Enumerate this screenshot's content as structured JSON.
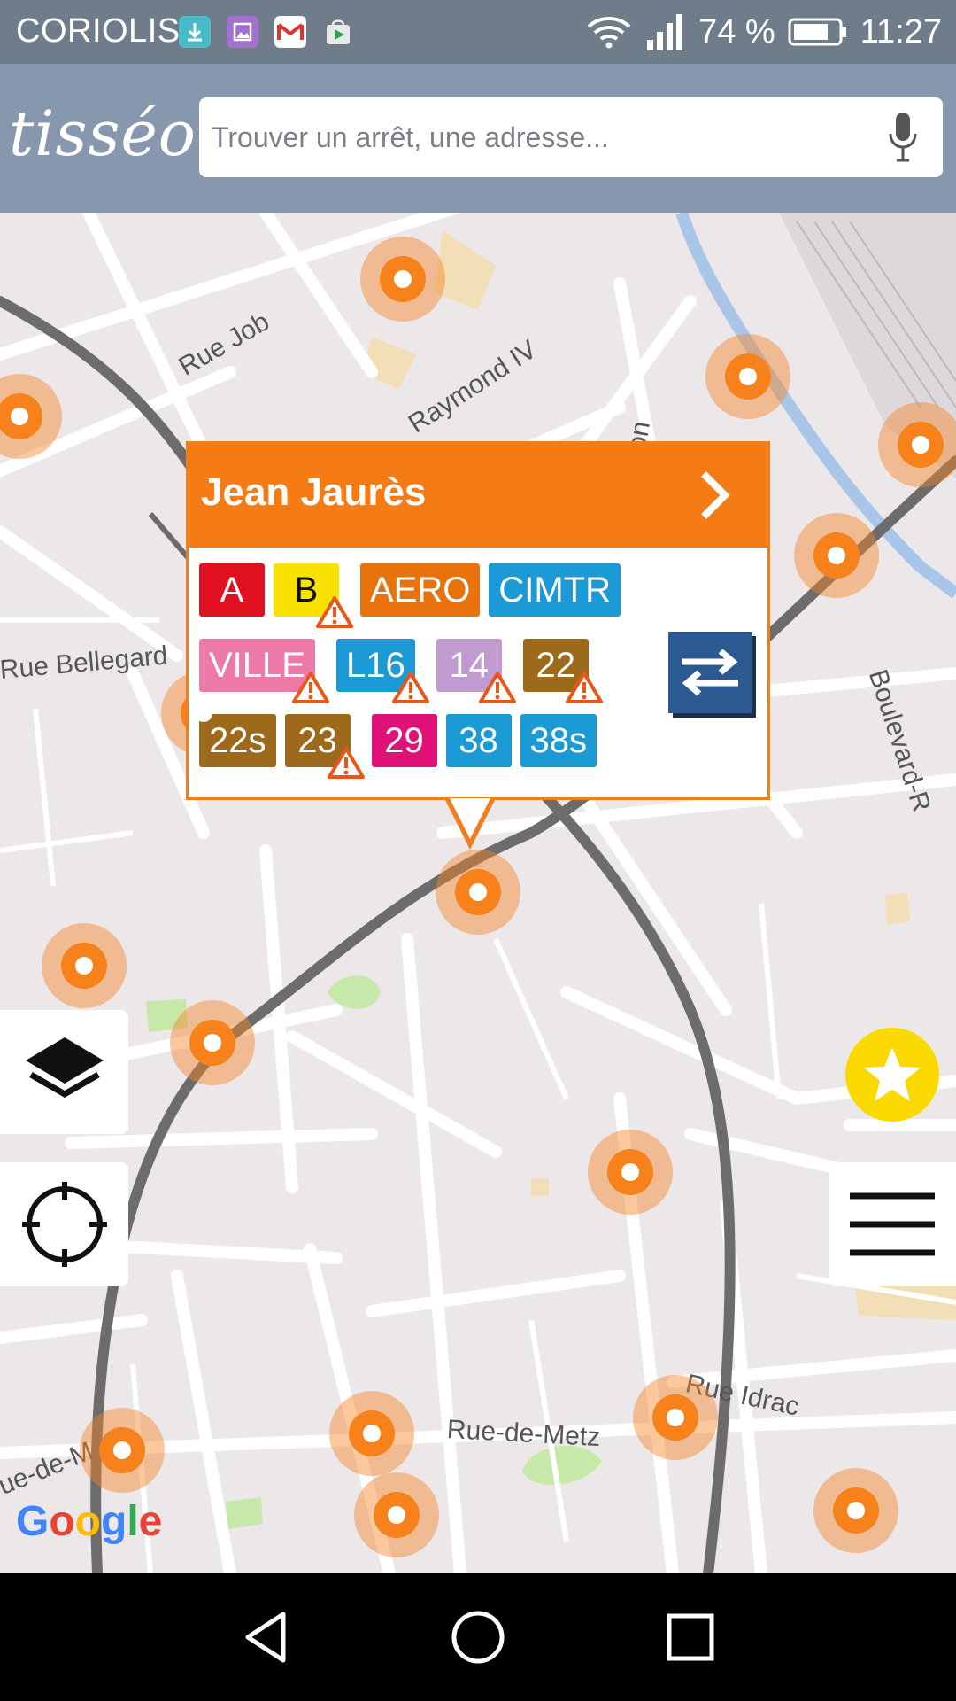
{
  "status_bar": {
    "carrier": "CORIOLIS",
    "battery": "74 %",
    "time": "11:27",
    "icons": [
      "download-icon",
      "gallery-icon",
      "gmail-icon",
      "play-store-icon",
      "wifi-icon",
      "signal-icon",
      "battery-icon"
    ]
  },
  "header": {
    "logo": "tisséo",
    "search_placeholder": "Trouver un arrêt, une adresse...",
    "mic_icon": "microphone-icon"
  },
  "map": {
    "street_labels": [
      "Rue Job",
      "Raymond IV",
      "Rue Bellegard",
      "Boulevard-R",
      "Rue Idrac",
      "Rue-de-Metz",
      "ue-de-M",
      "fon"
    ],
    "attribution": "Google"
  },
  "popup": {
    "stop_name": "Jean Jaurès",
    "lines": [
      [
        {
          "label": "A",
          "bg": "#df1020",
          "fg": "#ffffff",
          "alert": false
        },
        {
          "label": "B",
          "bg": "#f9e200",
          "fg": "#111111",
          "alert": true
        },
        {
          "label": "AERO",
          "bg": "#e8730c",
          "fg": "#ffffff",
          "alert": false
        },
        {
          "label": "CIMTR",
          "bg": "#1c9ad6",
          "fg": "#ffffff",
          "alert": false
        }
      ],
      [
        {
          "label": "VILLE",
          "bg": "#ec79a8",
          "fg": "#ffffff",
          "alert": true
        },
        {
          "label": "L16",
          "bg": "#1c9ad6",
          "fg": "#ffffff",
          "alert": true
        },
        {
          "label": "14",
          "bg": "#c09ad0",
          "fg": "#ffffff",
          "alert": true
        },
        {
          "label": "22",
          "bg": "#9c6a1a",
          "fg": "#ffffff",
          "alert": true
        }
      ],
      [
        {
          "label": "22s",
          "bg": "#9c6a1a",
          "fg": "#ffffff",
          "alert": false
        },
        {
          "label": "23",
          "bg": "#9c6a1a",
          "fg": "#ffffff",
          "alert": true
        },
        {
          "label": "29",
          "bg": "#e0127a",
          "fg": "#ffffff",
          "alert": false
        },
        {
          "label": "38",
          "bg": "#1c9ad6",
          "fg": "#ffffff",
          "alert": false
        },
        {
          "label": "38s",
          "bg": "#1c9ad6",
          "fg": "#ffffff",
          "alert": false
        }
      ]
    ]
  },
  "controls": {
    "layers": "layers-icon",
    "locate": "crosshair-icon",
    "favorites": "star-icon",
    "menu": "hamburger-menu-icon"
  },
  "colors": {
    "accent": "#f57c15",
    "header": "#8797ad",
    "status_bar": "#6f7d8a",
    "favorite": "#fad900"
  },
  "nav_bar": [
    "back-icon",
    "home-icon",
    "recents-icon"
  ]
}
